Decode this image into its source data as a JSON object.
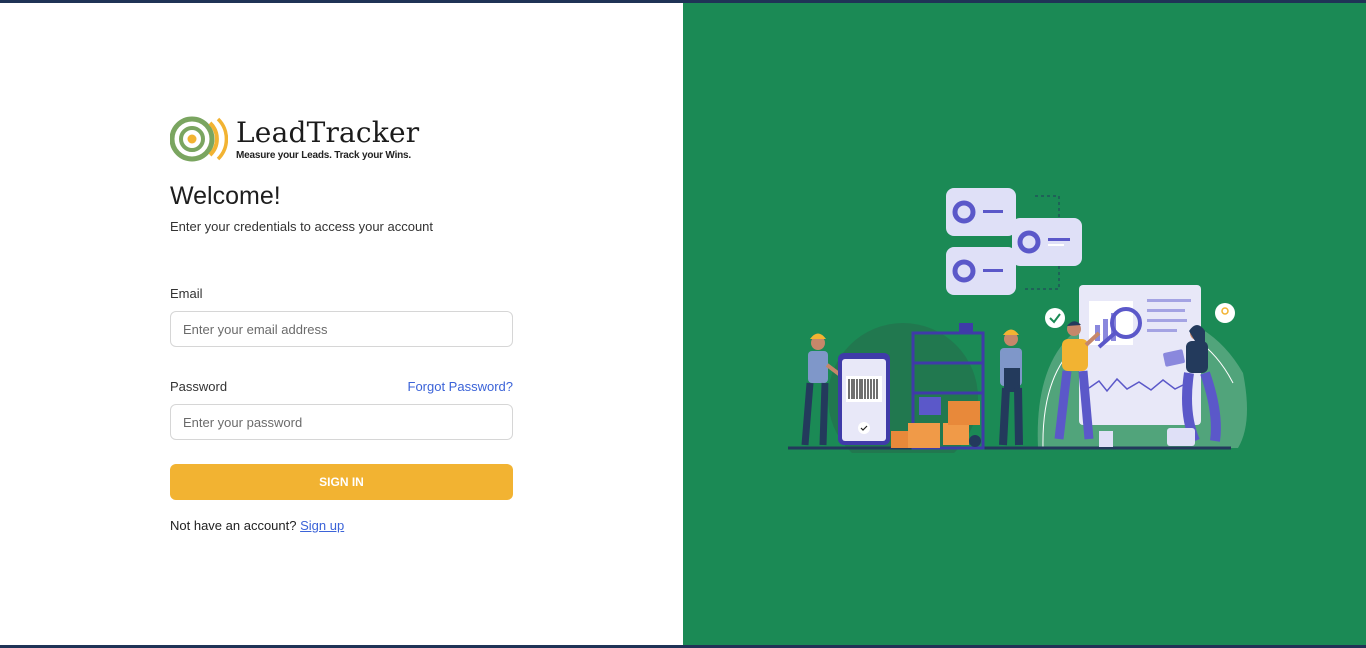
{
  "brand": {
    "name": "LeadTracker",
    "tagline": "Measure your Leads. Track your Wins."
  },
  "header": {
    "title": "Welcome!",
    "subtitle": "Enter your credentials to access your account"
  },
  "form": {
    "email_label": "Email",
    "email_placeholder": "Enter your email address",
    "email_value": "",
    "password_label": "Password",
    "password_placeholder": "Enter your password",
    "password_value": "",
    "forgot_label": "Forgot Password?",
    "submit_label": "SIGN IN"
  },
  "footer": {
    "prompt": "Not have an account?",
    "signup_label": "Sign up"
  },
  "colors": {
    "accent": "#f2b332",
    "link": "#3b63d8",
    "panel": "#1b8a55"
  },
  "icons": [
    "target-logo-icon",
    "barcode-icon",
    "magnifier-icon",
    "chart-icon"
  ]
}
